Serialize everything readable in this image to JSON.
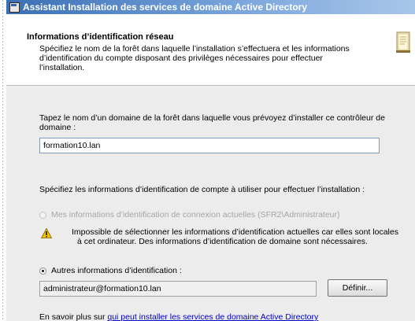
{
  "window": {
    "title": "Assistant Installation des services de domaine Active Directory"
  },
  "header": {
    "title": "Informations d’identification réseau",
    "description": "Spécifiez le nom de la forêt dans laquelle l’installation s’effectuera et les informations d’identification du compte disposant des privilèges nécessaires pour effectuer l’installation."
  },
  "form": {
    "domain_label": "Tapez le nom d’un domaine de la forêt dans laquelle vous prévoyez d’installer ce contrôleur de domaine :",
    "domain_value": "formation10.lan",
    "credentials_label": "Spécifiez les informations d’identification de compte à utiliser pour effectuer l’installation :",
    "option_current": "Mes informations d’identification de connexion actuelles (SFR2\\Administrateur)",
    "option_current_checked": false,
    "option_current_enabled": false,
    "warning_line1": "Impossible de sélectionner les informations d’identification actuelles car elles sont locales",
    "warning_line2": "à cet ordinateur. Des informations d’identification de domaine sont nécessaires.",
    "option_other": "Autres informations d’identification :",
    "option_other_checked": true,
    "account_value": "administrateur@formation10.lan",
    "define_button": "Définir...",
    "learn_more_prefix": "En savoir plus sur ",
    "learn_more_link": "qui peut installer les services de domaine Active Directory"
  },
  "colors": {
    "titlebar": "#3a6fb5",
    "panel_bg": "#ececec",
    "link": "#0000cc",
    "warning": "#f2c200"
  },
  "icons": {
    "app": "window-app-icon",
    "header": "book-icon",
    "warning": "warning-icon"
  }
}
